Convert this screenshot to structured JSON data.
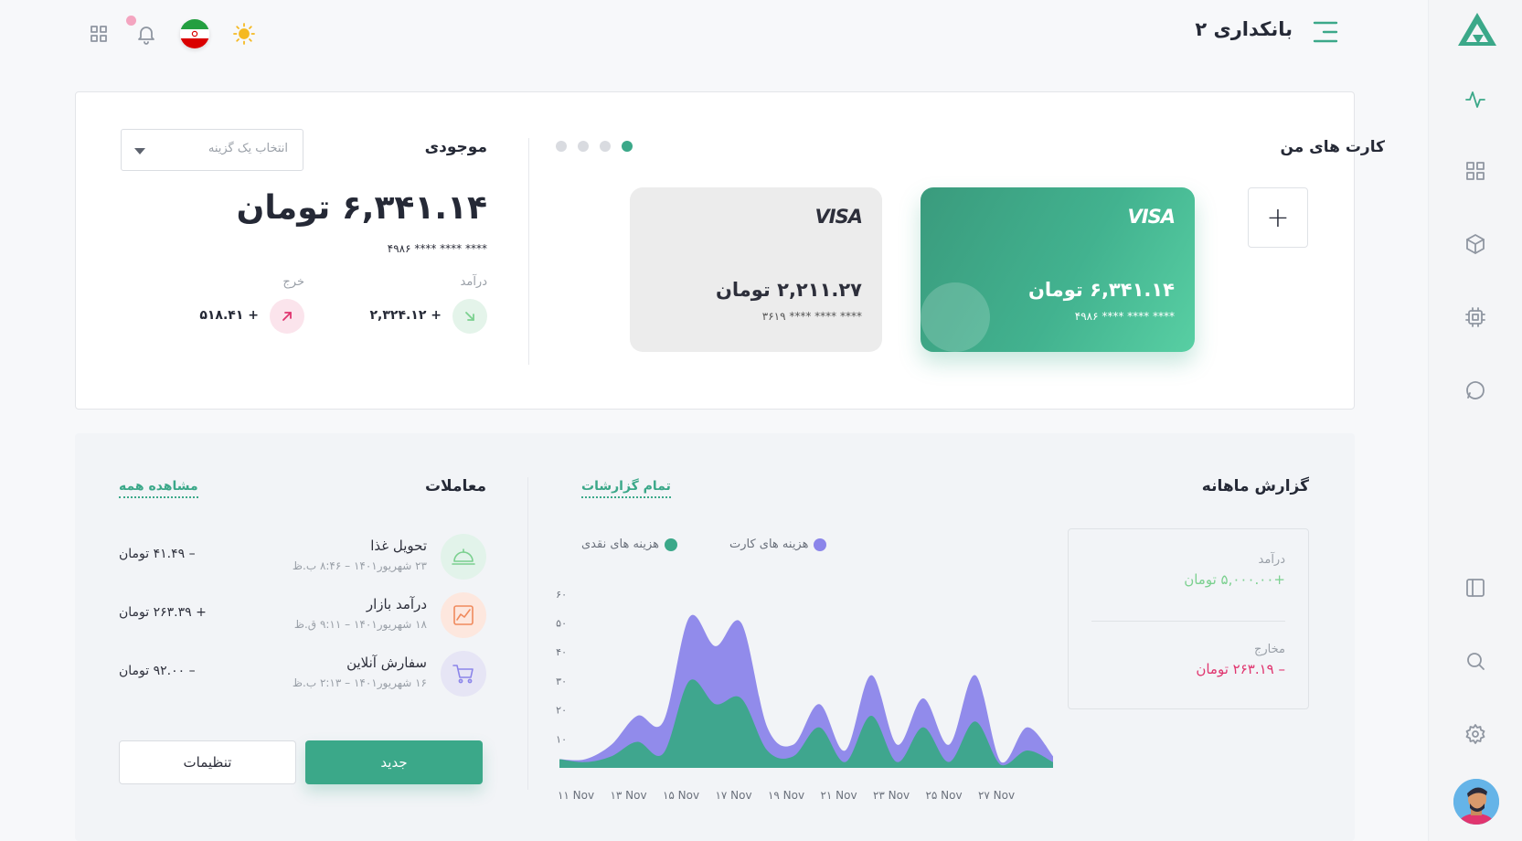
{
  "app": {
    "title": "بانکداری ۲"
  },
  "my_cards": {
    "title": "کارت های من",
    "add_label": "+",
    "cards": [
      {
        "brand": "VISA",
        "amount": "۶,۳۴۱.۱۴ تومان",
        "number": "**** **** **** ۴۹۸۶",
        "color": "#42b28f"
      },
      {
        "brand": "VISA",
        "amount": "۲,۲۱۱.۲۷ تومان",
        "number": "**** **** **** ۳۶۱۹",
        "color": "#ececec"
      }
    ],
    "active_page": 1,
    "page_count": 4
  },
  "balance": {
    "title": "موجودی",
    "select_placeholder": "انتخاب یک گزینه",
    "amount": "۶,۳۴۱.۱۴ تومان",
    "card_number": "**** **** **** ۴۹۸۶",
    "income_label": "درآمد",
    "income_value": "+ ۲,۳۲۴.۱۲",
    "expense_label": "خرج",
    "expense_value": "+ ۵۱۸.۴۱"
  },
  "monthly_report": {
    "title": "گزارش ماهانه",
    "all_reports_link": "تمام گزارشات",
    "legend": [
      {
        "name": "هزینه های کارت",
        "color": "#8b85ea"
      },
      {
        "name": "هزینه های نقدی",
        "color": "#3ba889"
      }
    ],
    "summary": {
      "income_label": "درآمد",
      "income_value": "+۵,۰۰۰.۰۰ تومان",
      "income_color": "#7bd08f",
      "expense_label": "مخارج",
      "expense_value": "– ۲۶۳.۱۹ تومان",
      "expense_color": "#e0356f"
    }
  },
  "chart_data": {
    "type": "area",
    "x": [
      "۱۱ Nov",
      "۱۳ Nov",
      "۱۵ Nov",
      "۱۷ Nov",
      "۱۹ Nov",
      "۲۱ Nov",
      "۲۳ Nov",
      "۲۵ Nov",
      "۲۷ Nov"
    ],
    "y_ticks": [
      "۱۰",
      "۲۰",
      "۳۰",
      "۴۰",
      "۵۰",
      "۶۰"
    ],
    "ylim": [
      0,
      65
    ],
    "series": [
      {
        "name": "هزینه های کارت",
        "values": [
          3,
          3,
          8,
          18,
          16,
          52,
          42,
          50,
          14,
          8,
          22,
          6,
          32,
          8,
          24,
          8,
          32,
          2,
          14,
          4
        ],
        "color": "#8b85ea"
      },
      {
        "name": "هزینه های نقدی",
        "values": [
          3,
          2,
          4,
          9,
          5,
          30,
          22,
          24,
          6,
          4,
          14,
          2,
          18,
          2,
          14,
          2,
          16,
          1,
          6,
          2
        ],
        "color": "#3ba889"
      }
    ]
  },
  "transactions": {
    "title": "معاملات",
    "view_all": "مشاهده همه",
    "items": [
      {
        "title": "تحویل غذا",
        "date": "۲۳ شهریور۱۴۰۱ – ۸:۴۶ ب.ظ",
        "amount": "– ۴۱.۴۹ تومان",
        "icon": "food-cloche-icon",
        "color": "#3ba889"
      },
      {
        "title": "درآمد بازار",
        "date": "۱۸ شهریور۱۴۰۱ – ۹:۱۱ ق.ظ",
        "amount": "+ ۲۶۳.۳۹ تومان",
        "icon": "market-chart-icon",
        "color": "#f08a5d"
      },
      {
        "title": "سفارش آنلاین",
        "date": "۱۶ شهریور۱۴۰۱ – ۲:۱۳ ب.ظ",
        "amount": "– ۹۲.۰۰ تومان",
        "icon": "shopping-cart-icon",
        "color": "#8b85ea"
      }
    ],
    "new_button": "جدید",
    "settings_button": "تنظیمات"
  }
}
